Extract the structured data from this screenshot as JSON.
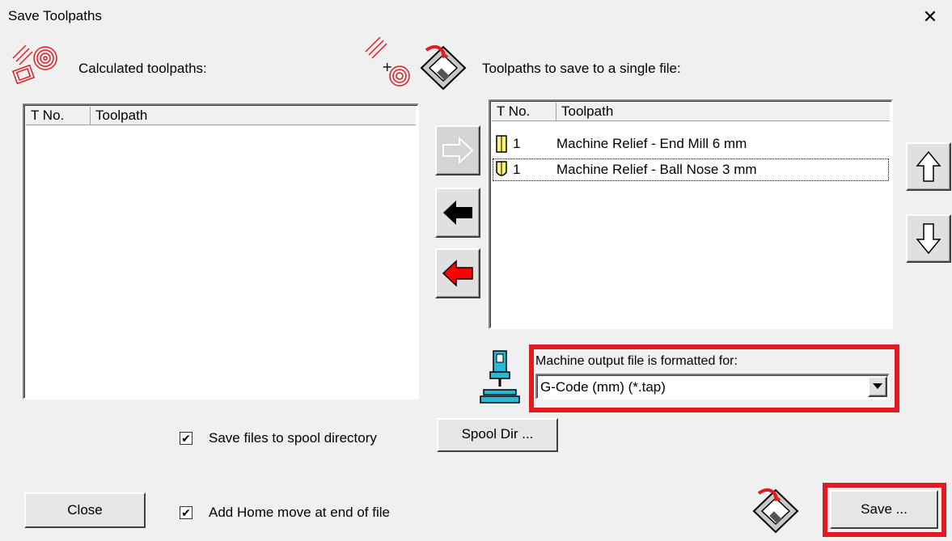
{
  "window": {
    "title": "Save Toolpaths",
    "close_glyph": "✕"
  },
  "left_panel": {
    "label": "Calculated toolpaths:",
    "icon": "calculated-toolpaths-icon",
    "columns": [
      "T No.",
      "Toolpath"
    ],
    "rows": []
  },
  "right_panel": {
    "label": "Toolpaths to save to a single file:",
    "icon": "add-to-save-list-icon",
    "columns": [
      "T No.",
      "Toolpath"
    ],
    "rows": [
      {
        "tool_no": "1",
        "toolpath": "Machine Relief - End Mill 6 mm",
        "icon": "end-mill-icon"
      },
      {
        "tool_no": "1",
        "toolpath": "Machine Relief - Ball Nose 3 mm",
        "icon": "ball-nose-icon"
      }
    ]
  },
  "transfer_buttons": {
    "add": {
      "icon": "arrow-right-icon",
      "enabled": false
    },
    "remove": {
      "icon": "arrow-left-black-icon",
      "enabled": true
    },
    "remove_all": {
      "icon": "arrow-left-red-icon",
      "enabled": true
    }
  },
  "order_buttons": {
    "up": "arrow-up-icon",
    "down": "arrow-down-icon"
  },
  "machine_output": {
    "label": "Machine output file is formatted for:",
    "selected": "G-Code (mm) (*.tap)",
    "highlight_color": "#e11b22"
  },
  "options": {
    "save_to_spool": {
      "label": "Save files to spool directory",
      "checked": true
    },
    "add_home_move": {
      "label": "Add Home move at end of file",
      "checked": true
    },
    "check_glyph": "✔"
  },
  "buttons": {
    "spool_dir": "Spool Dir ...",
    "close": "Close",
    "save": "Save ..."
  }
}
